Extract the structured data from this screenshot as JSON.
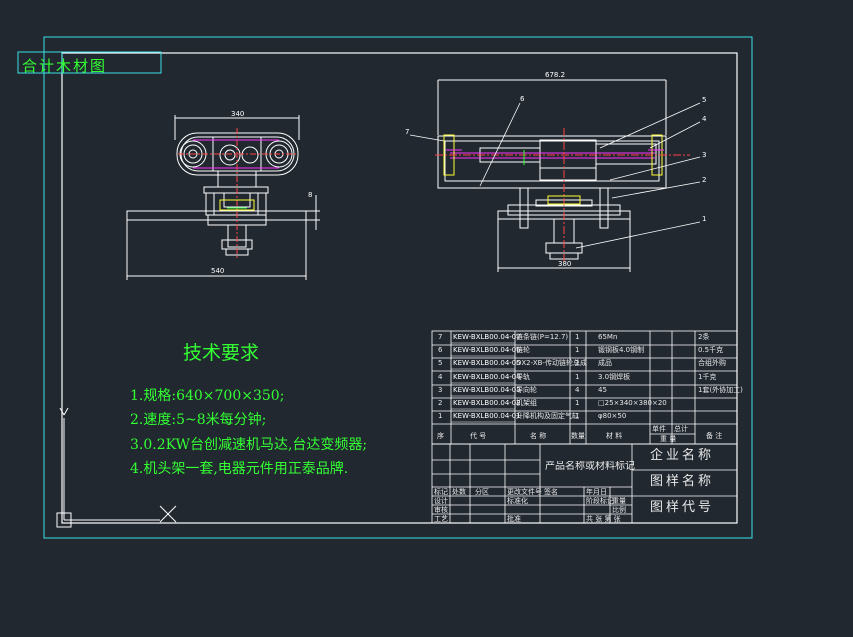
{
  "stamp": {
    "label": "合计木材图"
  },
  "dims": {
    "side_top": "340",
    "side_bottom": "540",
    "side_right": "8",
    "front_top": "678.2",
    "front_bottom": "380"
  },
  "balloons": [
    "1",
    "2",
    "3",
    "4",
    "5",
    "6",
    "7"
  ],
  "tech": {
    "title": "技术要求",
    "lines": [
      "1.规格:640×700×350;",
      "2.速度:5~8米每分钟;",
      "3.0.2KW台创减速机马达,台达变频器;",
      "4.机头架一套,电器元件用正泰品牌."
    ]
  },
  "bom": {
    "rows": [
      {
        "no": "7",
        "code": "KEW-BXLB00.04-07",
        "name": "链条链(P=12.7)",
        "qty": "1",
        "material": "65Mn",
        "note": "2条"
      },
      {
        "no": "6",
        "code": "KEW-BXLB00.04-06",
        "name": "链轮",
        "qty": "1",
        "material": "锻钢板4.0钢制",
        "note": "0.5千克"
      },
      {
        "no": "5",
        "code": "KEW-BXLB00.04-05",
        "name": "DX2-XB-传动链轮总成",
        "qty": "1",
        "material": "成品",
        "note": "合组外购"
      },
      {
        "no": "4",
        "code": "KEW-BXLB00.04-04",
        "name": "导轨",
        "qty": "1",
        "material": "3.0钢焊板",
        "note": "1千克"
      },
      {
        "no": "3",
        "code": "KEW-BXLB00.04-03",
        "name": "导向轮",
        "qty": "4",
        "material": "45",
        "note": "1套(外协加工)"
      },
      {
        "no": "2",
        "code": "KEW-BXLB00.04-02",
        "name": "机架组",
        "qty": "1",
        "material": "□25×340×380×20",
        "note": ""
      },
      {
        "no": "1",
        "code": "KEW-BXLB00.04-01",
        "name": "升降机构及固定气缸",
        "qty": "1",
        "material": "φ80×50",
        "note": ""
      }
    ],
    "header": {
      "no": "序",
      "code": "代 号",
      "name": "名 称",
      "qty": "数量",
      "material": "材 料",
      "w1": "单件",
      "w2": "总计",
      "weight": "重 量",
      "note": "备 注"
    }
  },
  "title_block": {
    "product": "产品名称或材料标记",
    "company": "企业名称",
    "drawing_name": "图样名称",
    "drawing_code": "图样代号",
    "row_labels": [
      "标记",
      "处数",
      "分区",
      "更改文件号",
      "签名",
      "年月日"
    ],
    "design": "设计",
    "std": "标准化",
    "stage": "阶段标记",
    "weight": "重量",
    "scale": "比例",
    "review": "审核",
    "craft": "工艺",
    "approve": "批准",
    "sheet": "共 张 第 张"
  },
  "colors": {
    "frame": "#3ce1e6",
    "outline": "#ffffff",
    "green": "#33ff33",
    "magenta": "#ff33ff",
    "red": "#ff4444",
    "yellow": "#ffff33"
  }
}
